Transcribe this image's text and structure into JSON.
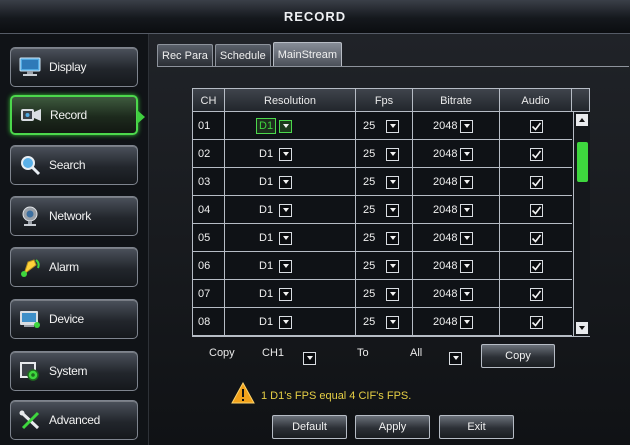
{
  "window": {
    "title": "RECORD"
  },
  "sidebar": {
    "items": [
      {
        "label": "Display"
      },
      {
        "label": "Record"
      },
      {
        "label": "Search"
      },
      {
        "label": "Network"
      },
      {
        "label": "Alarm"
      },
      {
        "label": "Device"
      },
      {
        "label": "System"
      },
      {
        "label": "Advanced"
      }
    ],
    "active_item": "Record"
  },
  "tabs": [
    {
      "label": "Rec Para"
    },
    {
      "label": "Schedule"
    },
    {
      "label": "MainStream"
    }
  ],
  "active_tab": "MainStream",
  "table": {
    "headers": [
      "CH",
      "Resolution",
      "Fps",
      "Bitrate",
      "Audio"
    ],
    "rows": [
      {
        "ch": "01",
        "resolution": "D1",
        "fps": "25",
        "bitrate": "2048",
        "audio": true
      },
      {
        "ch": "02",
        "resolution": "D1",
        "fps": "25",
        "bitrate": "2048",
        "audio": true
      },
      {
        "ch": "03",
        "resolution": "D1",
        "fps": "25",
        "bitrate": "2048",
        "audio": true
      },
      {
        "ch": "04",
        "resolution": "D1",
        "fps": "25",
        "bitrate": "2048",
        "audio": true
      },
      {
        "ch": "05",
        "resolution": "D1",
        "fps": "25",
        "bitrate": "2048",
        "audio": true
      },
      {
        "ch": "06",
        "resolution": "D1",
        "fps": "25",
        "bitrate": "2048",
        "audio": true
      },
      {
        "ch": "07",
        "resolution": "D1",
        "fps": "25",
        "bitrate": "2048",
        "audio": true
      },
      {
        "ch": "08",
        "resolution": "D1",
        "fps": "25",
        "bitrate": "2048",
        "audio": true
      }
    ]
  },
  "copy": {
    "label": "Copy",
    "from_value": "CH1",
    "to_label": "To",
    "to_value": "All",
    "button_label": "Copy"
  },
  "warning": {
    "text": "1 D1's FPS equal 4 CIF's FPS."
  },
  "buttons": {
    "default_label": "Default",
    "apply_label": "Apply",
    "exit_label": "Exit"
  },
  "colors": {
    "accent": "#3ed63e",
    "warning": "#e6cf45"
  }
}
